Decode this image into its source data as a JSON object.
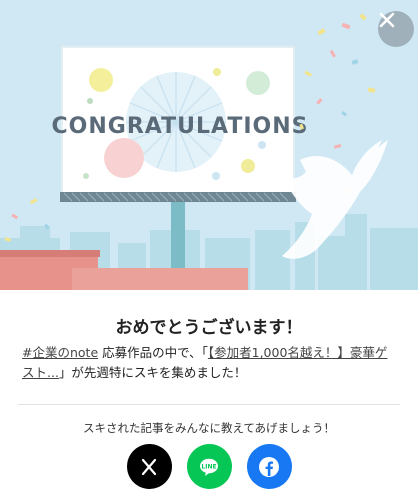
{
  "hero": {
    "billboard_text": "CONGRATULATIONS",
    "colors": {
      "sky": "#cfe8f4",
      "board": "#ffffff",
      "text": "#5a6a78"
    }
  },
  "close": {
    "icon": "close-icon"
  },
  "title": "おめでとうございます！",
  "message": {
    "tag_link": "#企業のnote",
    "text_before": " 応募作品の中で、「",
    "article_link": "【参加者1,000名越え！】豪華ゲスト...",
    "text_after": "」が先週特にスキを集めました！"
  },
  "share": {
    "prompt": "スキされた記事をみんなに教えてあげましょう！",
    "buttons": [
      {
        "name": "x-share",
        "icon": "x-logo-icon",
        "color": "#000000"
      },
      {
        "name": "line-share",
        "icon": "line-logo-icon",
        "color": "#06c755",
        "label": "LINE"
      },
      {
        "name": "facebook-share",
        "icon": "facebook-logo-icon",
        "color": "#1877f2"
      }
    ]
  }
}
